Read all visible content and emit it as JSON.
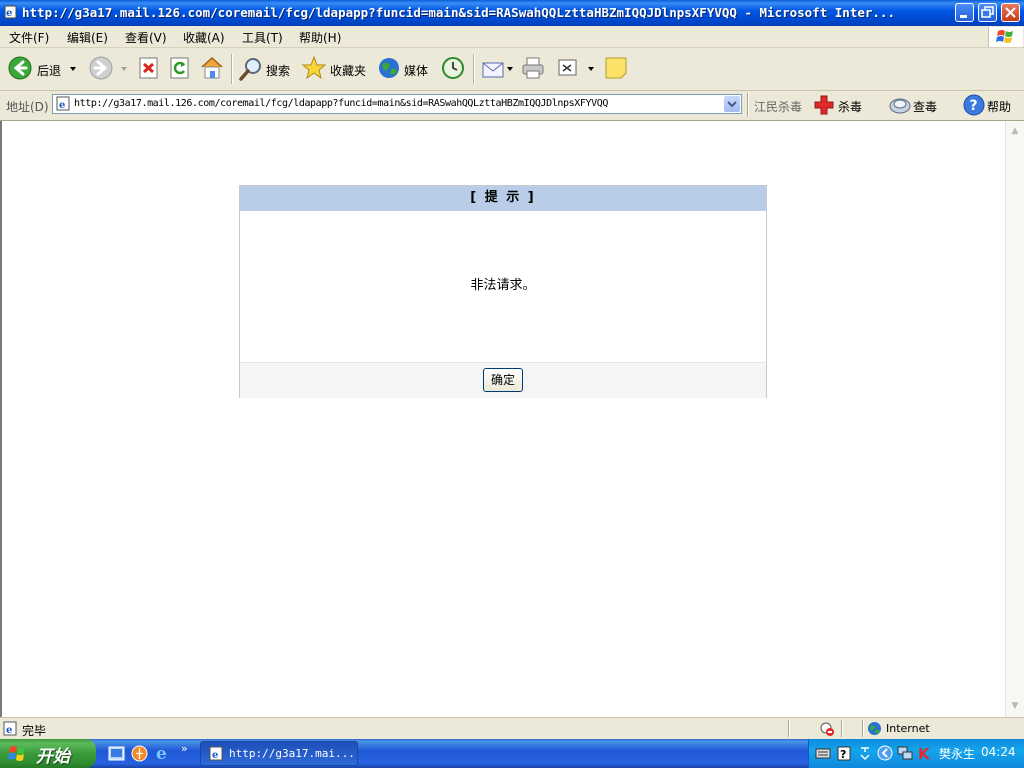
{
  "window": {
    "title": "http://g3a17.mail.126.com/coremail/fcg/ldapapp?funcid=main&sid=RASwahQQLzttaHBZmIQQJDlnpsXFYVQQ - Microsoft Inter..."
  },
  "menu": {
    "items": [
      "文件(F)",
      "编辑(E)",
      "查看(V)",
      "收藏(A)",
      "工具(T)",
      "帮助(H)"
    ]
  },
  "toolbar": {
    "back_label": "后退",
    "search_label": "搜索",
    "favorites_label": "收藏夹",
    "media_label": "媒体"
  },
  "address": {
    "label": "地址(D)",
    "url": "http://g3a17.mail.126.com/coremail/fcg/ldapapp?funcid=main&sid=RASwahQQLzttaHBZmIQQJDlnpsXFYVQQ",
    "antivirus_brand": "江民杀毒",
    "kill_label": "杀毒",
    "scan_label": "查毒",
    "help_label": "帮助"
  },
  "dialog": {
    "header": "[ 提 示 ]",
    "message": "非法请求。",
    "ok_label": "确定"
  },
  "status": {
    "text": "完毕",
    "zone": "Internet"
  },
  "taskbar": {
    "start_label": "开始",
    "task_label": "http://g3a17.mai...",
    "user": "樊永生",
    "clock": "04:24"
  }
}
